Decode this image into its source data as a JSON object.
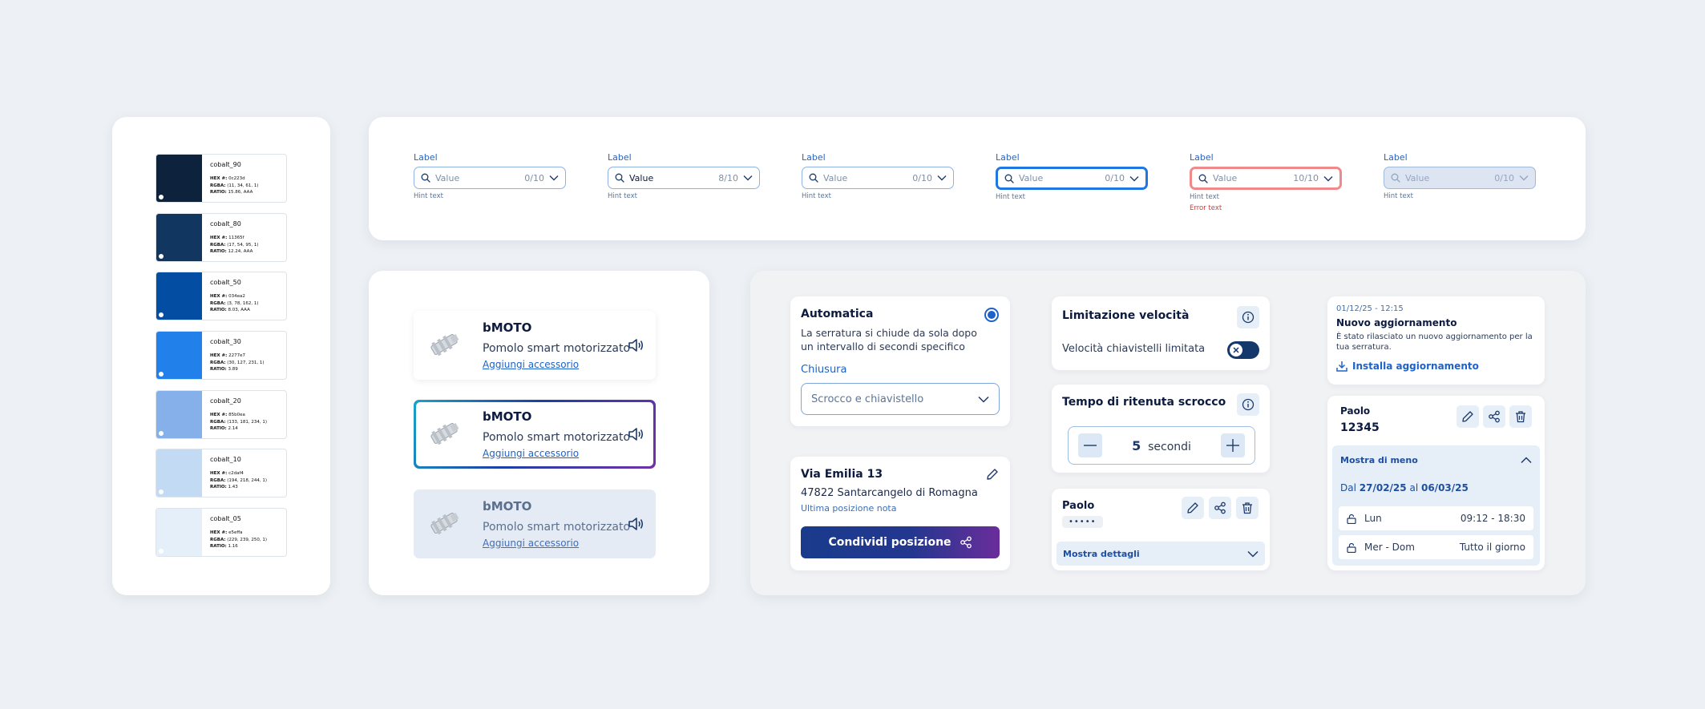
{
  "palette": {
    "swatches": [
      {
        "name": "cobalt_90",
        "hex": "0c223d",
        "rgba": "(11, 34, 61, 1)",
        "ratio": "15.86, AAA",
        "color": "#0c223d"
      },
      {
        "name": "cobalt_80",
        "hex": "11365f",
        "rgba": "(17, 54, 95, 1)",
        "ratio": "12.24, AAA",
        "color": "#11365f"
      },
      {
        "name": "cobalt_50",
        "hex": "034ea2",
        "rgba": "(3, 78, 162, 1)",
        "ratio": "8.03, AAA",
        "color": "#034ea2"
      },
      {
        "name": "cobalt_30",
        "hex": "2277e7",
        "rgba": "(30, 127, 231, 1)",
        "ratio": "3.89",
        "color": "#2280ea"
      },
      {
        "name": "cobalt_20",
        "hex": "85b0ea",
        "rgba": "(133, 181, 234, 1)",
        "ratio": "2.14",
        "color": "#85b0ea"
      },
      {
        "name": "cobalt_10",
        "hex": "c2daf4",
        "rgba": "(194, 218, 244, 1)",
        "ratio": "1.43",
        "color": "#c2daf4"
      },
      {
        "name": "cobalt_05",
        "hex": "e5effa",
        "rgba": "(229, 239, 250, 1)",
        "ratio": "1.16",
        "color": "#e5effa"
      }
    ],
    "labels": {
      "hex": "HEX #:",
      "rgba": "RGBA:",
      "ratio": "RATIO:"
    }
  },
  "inputs": [
    {
      "label": "Label",
      "value": "Value",
      "count": "0/10",
      "hint": "Hint text",
      "state": "default"
    },
    {
      "label": "Label",
      "value": "Value",
      "count": "8/10",
      "hint": "Hint text",
      "state": "filled"
    },
    {
      "label": "Label",
      "value": "Value",
      "count": "0/10",
      "hint": "Hint text",
      "state": "default"
    },
    {
      "label": "Label",
      "value": "Value",
      "count": "0/10",
      "hint": "Hint text",
      "state": "focus"
    },
    {
      "label": "Label",
      "value": "Value",
      "count": "10/10",
      "hint": "Hint text",
      "error": "Error text",
      "state": "error"
    },
    {
      "label": "Label",
      "value": "Value",
      "count": "0/10",
      "hint": "Hint text",
      "state": "disabled"
    }
  ],
  "products": [
    {
      "title": "bMOTO",
      "subtitle": "Pomolo smart motorizzato",
      "link": "Aggiungi accessorio",
      "state": "default"
    },
    {
      "title": "bMOTO",
      "subtitle": "Pomolo smart motorizzato",
      "link": "Aggiungi accessorio",
      "state": "selected"
    },
    {
      "title": "bMOTO",
      "subtitle": "Pomolo smart motorizzato",
      "link": "Aggiungi accessorio",
      "state": "disabled"
    }
  ],
  "automatica": {
    "title": "Automatica",
    "description_line1": "La serratura si chiude da sola dopo",
    "description_line2": "un intervallo di secondi specifico",
    "select_label": "Chiusura",
    "select_value": "Scrocco e chiavistello"
  },
  "location": {
    "street": "Via Emilia 13",
    "city": "47822 Santarcangelo di Romagna",
    "note": "Ultima posizione nota",
    "share_label": "Condividi posizione"
  },
  "speed": {
    "title": "Limitazione velocità",
    "toggle_label": "Velocità chiavistelli limitata"
  },
  "hold": {
    "title": "Tempo di ritenuta scrocco",
    "value": "5",
    "unit": "secondi"
  },
  "user_card": {
    "name": "Paolo",
    "masked": "•••••",
    "details_label": "Mostra dettagli"
  },
  "update": {
    "timestamp": "01/12/25 - 12:15",
    "title": "Nuovo aggiornamento",
    "text_line1": "È stato rilasciato un nuovo aggiornamento per la",
    "text_line2": "tua serratura.",
    "install_label": "Installa aggiornamento"
  },
  "code_card": {
    "name": "Paolo",
    "code": "12345",
    "less_label": "Mostra di meno",
    "period_from_label": "Dal",
    "period_from": "27/02/25",
    "period_mid": "al",
    "period_to": "06/03/25",
    "slots": [
      {
        "day": "Lun",
        "time": "09:12 - 18:30"
      },
      {
        "day": "Mer - Dom",
        "time": "Tutto il giorno"
      }
    ]
  }
}
